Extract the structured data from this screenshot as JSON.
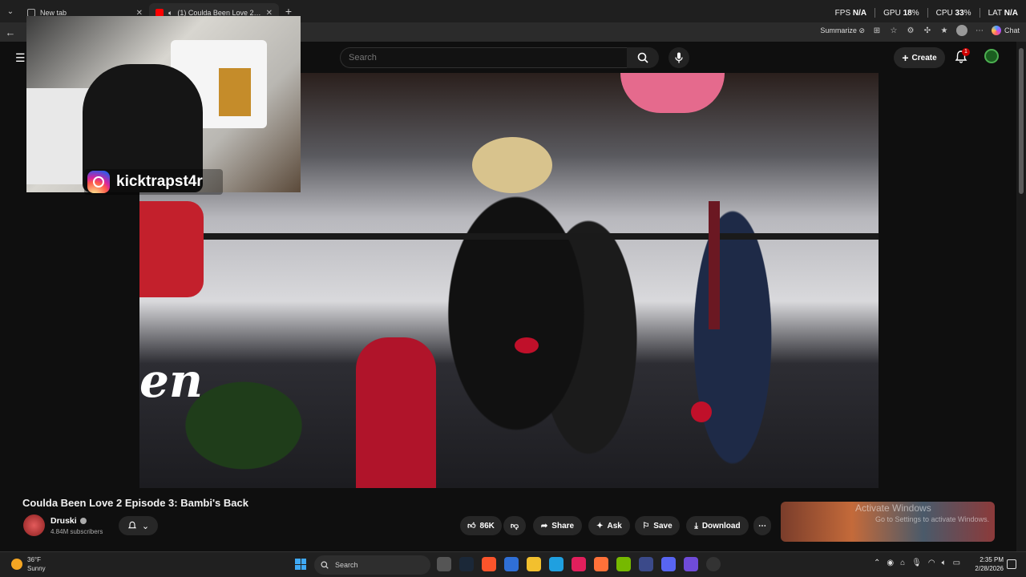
{
  "browser": {
    "tabs": [
      {
        "title": "New tab",
        "active": false
      },
      {
        "title": "(1) Coulda Been Love 2 Episode 3: Bambi's Back",
        "active": true
      }
    ],
    "perf": {
      "fps_label": "FPS",
      "fps": "N/A",
      "gpu_label": "GPU",
      "gpu": "18",
      "gpu_unit": "%",
      "cpu_label": "CPU",
      "cpu": "33",
      "cpu_unit": "%",
      "lat_label": "LAT",
      "lat": "N/A"
    },
    "toolbar": {
      "summarize": "Summarize",
      "chat": "Chat"
    }
  },
  "youtube": {
    "search_placeholder": "Search",
    "create_label": "Create",
    "notification_count": "1",
    "video": {
      "title": "Coulda Been Love 2 Episode 3: Bambi's Back",
      "channel": "Druski",
      "subscribers": "4.84M subscribers",
      "likes": "86K",
      "share": "Share",
      "ask": "Ask",
      "save": "Save",
      "download": "Download"
    },
    "overlay": {
      "instagram_handle": "kicktrapst4r"
    },
    "watermark": {
      "line1": "Activate Windows",
      "line2": "Go to Settings to activate Windows."
    }
  },
  "taskbar": {
    "weather_temp": "36°F",
    "weather_desc": "Sunny",
    "search_label": "Search",
    "time": "2:35 PM",
    "date": "2/28/2026"
  },
  "colors": {
    "accent_red": "#cc0000",
    "background": "#0f0f0f",
    "pill": "#272727"
  }
}
